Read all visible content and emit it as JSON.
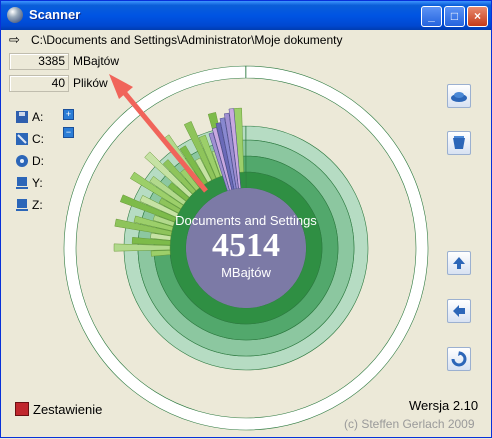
{
  "window": {
    "title": "Scanner"
  },
  "path": "C:\\Documents and Settings\\Administrator\\Moje dokumenty",
  "stats": [
    {
      "value": "3385",
      "label": "MBajtów"
    },
    {
      "value": "40",
      "label": "Plików"
    }
  ],
  "drives": [
    {
      "letter": "A:",
      "icon": "floppy-icon"
    },
    {
      "letter": "C:",
      "icon": "hard-disk-icon"
    },
    {
      "letter": "D:",
      "icon": "cd-drive-icon"
    },
    {
      "letter": "Y:",
      "icon": "network-drive-icon"
    },
    {
      "letter": "Z:",
      "icon": "network-drive-icon"
    }
  ],
  "center": {
    "name": "Documents and Settings",
    "size": "4514",
    "unit": "MBajtów"
  },
  "report_label": "Zestawienie",
  "version": "Wersja  2.10",
  "copyright": "(c) Steffen Gerlach 2009",
  "colors": {
    "titlebar": "#0054e3",
    "ring": "#3c9a4f",
    "center": "#7c7aa6",
    "arrow": "#f0645a"
  }
}
